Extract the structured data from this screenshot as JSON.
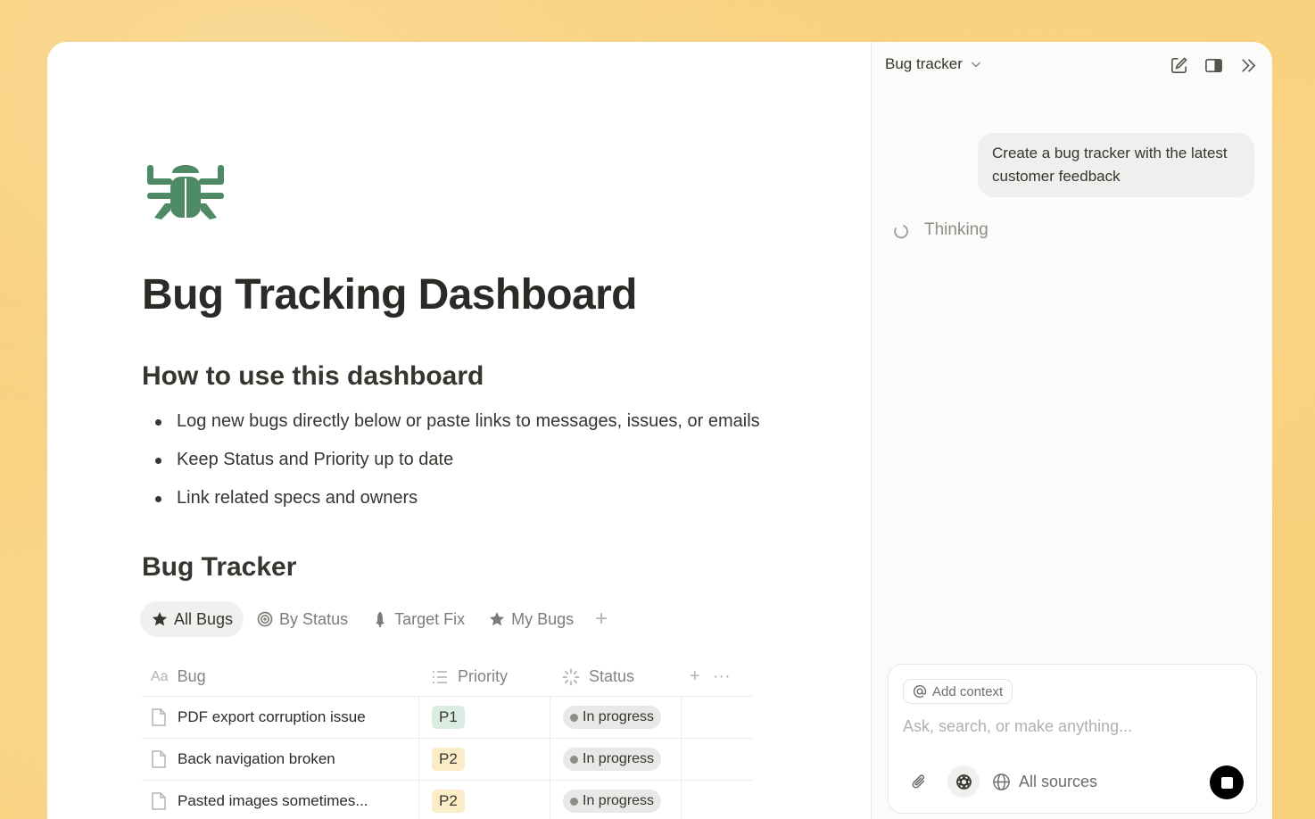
{
  "colors": {
    "bug_icon": "#4f8a66",
    "accent_p1": "#dbede2",
    "accent_p2": "#fbecc8"
  },
  "page": {
    "icon": "bug-icon",
    "title": "Bug Tracking Dashboard",
    "howto": {
      "heading": "How to use this dashboard",
      "bullets": [
        "Log new bugs directly below or paste links to messages, issues, or emails",
        "Keep Status and Priority up to date",
        "Link related specs and owners"
      ]
    },
    "tracker": {
      "heading": "Bug Tracker",
      "views": [
        {
          "label": "All Bugs",
          "icon": "star-icon"
        },
        {
          "label": "By Status",
          "icon": "target-icon"
        },
        {
          "label": "Target Fix",
          "icon": "rocket-icon"
        },
        {
          "label": "My Bugs",
          "icon": "star-icon"
        }
      ],
      "add_view": "+",
      "columns": [
        {
          "label": "Bug",
          "icon": "Aa"
        },
        {
          "label": "Priority",
          "icon": "list-icon"
        },
        {
          "label": "Status",
          "icon": "spinner-icon"
        }
      ],
      "column_actions": [
        "+",
        "···"
      ],
      "rows": [
        {
          "bug": "PDF export corruption issue",
          "priority": "P1",
          "status": "In progress"
        },
        {
          "bug": "Back navigation broken",
          "priority": "P2",
          "status": "In progress"
        },
        {
          "bug": "Pasted images sometimes...",
          "priority": "P2",
          "status": "In progress"
        }
      ]
    }
  },
  "side": {
    "title": "Bug tracker",
    "user_message": "Create a bug tracker with the latest customer feedback",
    "status": "Thinking",
    "composer": {
      "add_context": "Add context",
      "placeholder": "Ask, search, or make anything...",
      "sources": "All sources"
    }
  }
}
